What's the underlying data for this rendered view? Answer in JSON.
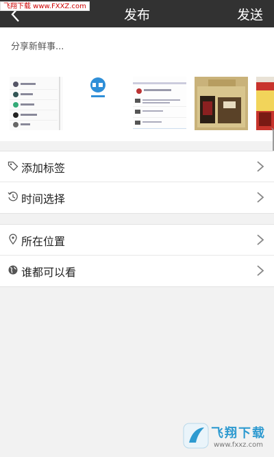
{
  "watermark_top": "飞翔下载 www.FXXZ.com",
  "header": {
    "title": "发布",
    "send_label": "发送"
  },
  "compose": {
    "placeholder": "分享新鲜事..."
  },
  "thumbnail_icons": [
    "screenshot-contacts",
    "app-logo",
    "screenshot-messages",
    "photo-box",
    "photo-package"
  ],
  "options_group_1": [
    {
      "label": "添加标签",
      "icon": "tag-icon"
    },
    {
      "label": "时间选择",
      "icon": "clock-icon"
    }
  ],
  "options_group_2": [
    {
      "label": "所在位置",
      "icon": "location-icon"
    },
    {
      "label": "谁都可以看",
      "icon": "globe-icon"
    }
  ],
  "watermark_bottom": {
    "logo": "飞翔下载",
    "url": "www.fxxz.com"
  },
  "colors": {
    "header_bg": "#323232",
    "page_bg": "#f2f2f2",
    "accent": "#2e9ad0"
  }
}
